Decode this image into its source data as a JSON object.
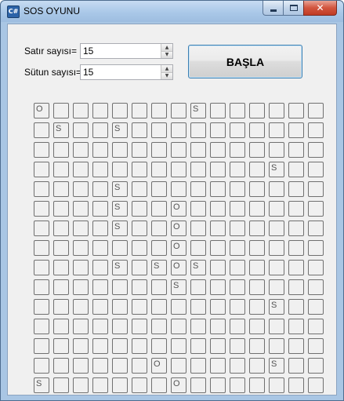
{
  "window": {
    "title": "SOS OYUNU",
    "icon": "app-icon",
    "controls": [
      "minimize-icon",
      "maximize-icon",
      "close-icon"
    ]
  },
  "form": {
    "rows_label": "Satır sayısı=",
    "rows_value": "15",
    "cols_label": "Sütun sayısı=",
    "cols_value": "15",
    "start_button": "BAŞLA"
  },
  "board": {
    "rows": 15,
    "cols": 15,
    "cells": [
      [
        "O",
        "",
        "",
        "",
        "",
        "",
        "",
        "",
        "S",
        "",
        "",
        "",
        "",
        "",
        ""
      ],
      [
        "",
        "S",
        "",
        "",
        "S",
        "",
        "",
        "",
        "",
        "",
        "",
        "",
        "",
        "",
        ""
      ],
      [
        "",
        "",
        "",
        "",
        "",
        "",
        "",
        "",
        "",
        "",
        "",
        "",
        "",
        "",
        ""
      ],
      [
        "",
        "",
        "",
        "",
        "",
        "",
        "",
        "",
        "",
        "",
        "",
        "",
        "S",
        "",
        ""
      ],
      [
        "",
        "",
        "",
        "",
        "S",
        "",
        "",
        "",
        "",
        "",
        "",
        "",
        "",
        "",
        ""
      ],
      [
        "",
        "",
        "",
        "",
        "S",
        "",
        "",
        "O",
        "",
        "",
        "",
        "",
        "",
        "",
        ""
      ],
      [
        "",
        "",
        "",
        "",
        "S",
        "",
        "",
        "O",
        "",
        "",
        "",
        "",
        "",
        "",
        ""
      ],
      [
        "",
        "",
        "",
        "",
        "",
        "",
        "",
        "O",
        "",
        "",
        "",
        "",
        "",
        "",
        ""
      ],
      [
        "",
        "",
        "",
        "",
        "S",
        "",
        "S",
        "O",
        "S",
        "",
        "",
        "",
        "",
        "",
        ""
      ],
      [
        "",
        "",
        "",
        "",
        "",
        "",
        "",
        "S",
        "",
        "",
        "",
        "",
        "",
        "",
        ""
      ],
      [
        "",
        "",
        "",
        "",
        "",
        "",
        "",
        "",
        "",
        "",
        "",
        "",
        "S",
        "",
        ""
      ],
      [
        "",
        "",
        "",
        "",
        "",
        "",
        "",
        "",
        "",
        "",
        "",
        "",
        "",
        "",
        ""
      ],
      [
        "",
        "",
        "",
        "",
        "",
        "",
        "",
        "",
        "",
        "",
        "",
        "",
        "",
        "",
        ""
      ],
      [
        "",
        "",
        "",
        "",
        "",
        "",
        "O",
        "",
        "",
        "",
        "",
        "",
        "S",
        "",
        ""
      ],
      [
        "S",
        "",
        "",
        "",
        "",
        "",
        "",
        "O",
        "",
        "",
        "",
        "",
        "",
        "",
        ""
      ]
    ]
  }
}
